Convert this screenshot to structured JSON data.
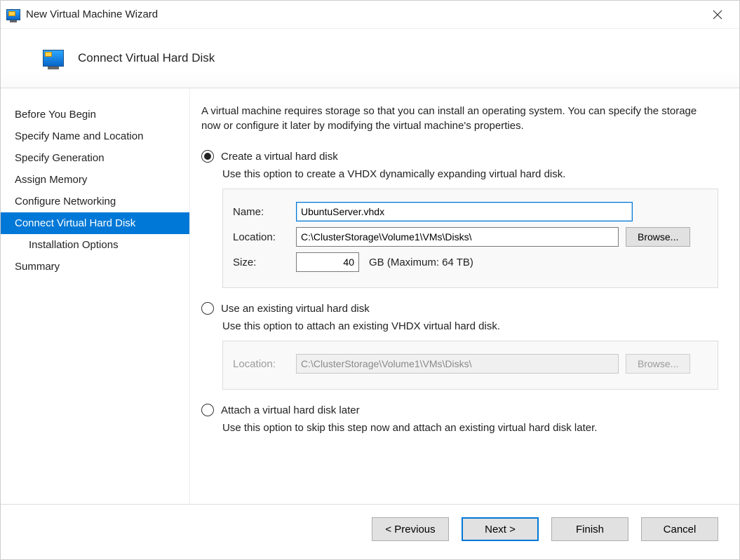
{
  "window": {
    "title": "New Virtual Machine Wizard"
  },
  "header": {
    "step_title": "Connect Virtual Hard Disk"
  },
  "sidebar": {
    "items": [
      {
        "label": "Before You Begin"
      },
      {
        "label": "Specify Name and Location"
      },
      {
        "label": "Specify Generation"
      },
      {
        "label": "Assign Memory"
      },
      {
        "label": "Configure Networking"
      },
      {
        "label": "Connect Virtual Hard Disk",
        "selected": true
      },
      {
        "label": "Installation Options",
        "indent": true
      },
      {
        "label": "Summary"
      }
    ]
  },
  "content": {
    "intro": "A virtual machine requires storage so that you can install an operating system. You can specify the storage now or configure it later by modifying the virtual machine's properties.",
    "option_create": {
      "label": "Create a virtual hard disk",
      "desc": "Use this option to create a VHDX dynamically expanding virtual hard disk.",
      "fields": {
        "name_label": "Name:",
        "name_value": "UbuntuServer.vhdx",
        "location_label": "Location:",
        "location_value": "C:\\ClusterStorage\\Volume1\\VMs\\Disks\\",
        "browse_label": "Browse...",
        "size_label": "Size:",
        "size_value": "40",
        "size_suffix": "GB (Maximum: 64 TB)"
      }
    },
    "option_existing": {
      "label": "Use an existing virtual hard disk",
      "desc": "Use this option to attach an existing VHDX virtual hard disk.",
      "fields": {
        "location_label": "Location:",
        "location_value": "C:\\ClusterStorage\\Volume1\\VMs\\Disks\\",
        "browse_label": "Browse..."
      }
    },
    "option_later": {
      "label": "Attach a virtual hard disk later",
      "desc": "Use this option to skip this step now and attach an existing virtual hard disk later."
    }
  },
  "footer": {
    "previous": "< Previous",
    "next": "Next >",
    "finish": "Finish",
    "cancel": "Cancel"
  }
}
